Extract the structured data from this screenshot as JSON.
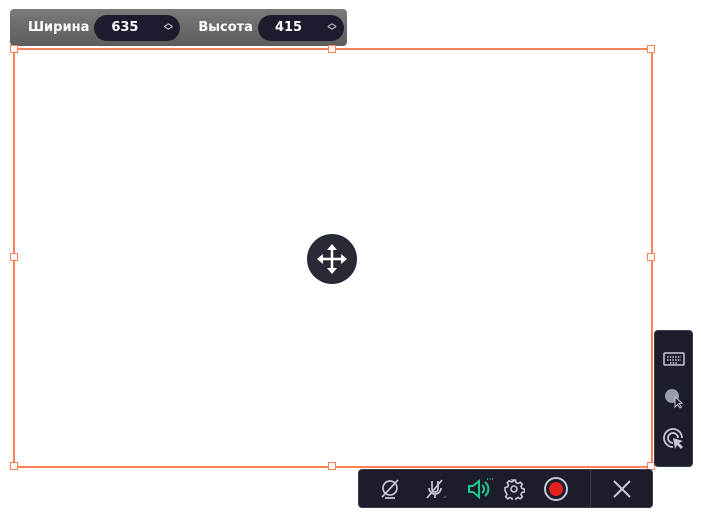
{
  "size_bar": {
    "width_label": "Ширина",
    "width_value": "635",
    "height_label": "Высота",
    "height_value": "415"
  },
  "colors": {
    "selection": "#ff8055",
    "panel": "#1b1d2a",
    "audio_active": "#1ec98e",
    "record": "#e32020"
  },
  "side_tools": [
    "keyboard-icon",
    "cursor-highlight-icon",
    "click-effect-icon"
  ],
  "bottom_tools": [
    "webcam-off-icon",
    "microphone-off-icon",
    "system-audio-icon",
    "settings-icon",
    "record-icon",
    "close-icon"
  ]
}
